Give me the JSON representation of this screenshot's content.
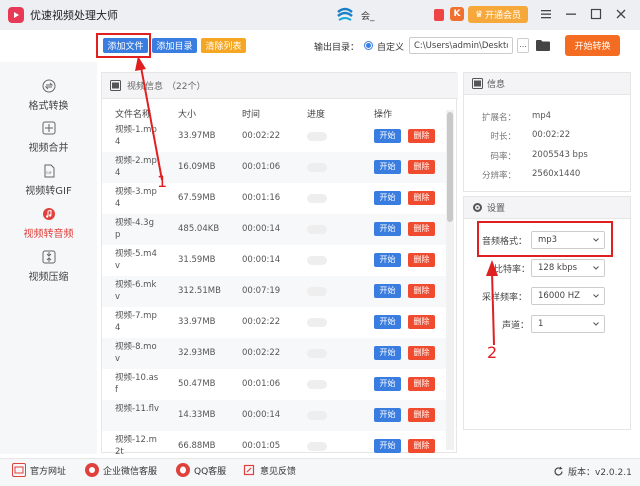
{
  "app": {
    "title": "优速视频处理大师",
    "user_name": "会_"
  },
  "vip": {
    "k_badge": "K",
    "label": "开通会员"
  },
  "toolbar": {
    "add_file": "添加文件",
    "add_dir": "添加目录",
    "clear_list": "清除列表",
    "output_dir_label": "输出目录：",
    "radio_custom": "自定义",
    "output_path": "C:\\Users\\admin\\Deskto",
    "more": "...",
    "start_convert": "开始转换"
  },
  "sidebar": {
    "items": [
      {
        "label": "格式转换",
        "icon": "format-convert-icon"
      },
      {
        "label": "视频合并",
        "icon": "video-merge-icon"
      },
      {
        "label": "视频转GIF",
        "icon": "gif-icon"
      },
      {
        "label": "视频转音频",
        "icon": "audio-icon",
        "active": true
      },
      {
        "label": "视频压缩",
        "icon": "compress-icon"
      }
    ]
  },
  "file_panel": {
    "title": "视频信息",
    "count": "（22个）",
    "columns": {
      "name": "文件名称",
      "size": "大小",
      "duration": "时间",
      "progress": "进度",
      "action": "操作"
    },
    "start_label": "开始",
    "delete_label": "删除",
    "rows": [
      {
        "name": "视频-1.mp4",
        "size": "33.97MB",
        "duration": "00:02:22"
      },
      {
        "name": "视频-2.mp4",
        "size": "16.09MB",
        "duration": "00:01:06"
      },
      {
        "name": "视频-3.mp4",
        "size": "67.59MB",
        "duration": "00:01:16"
      },
      {
        "name": "视频-4.3gp",
        "size": "485.04KB",
        "duration": "00:00:14"
      },
      {
        "name": "视频-5.m4v",
        "size": "31.59MB",
        "duration": "00:00:14"
      },
      {
        "name": "视频-6.mkv",
        "size": "312.51MB",
        "duration": "00:07:19"
      },
      {
        "name": "视频-7.mp4",
        "size": "33.97MB",
        "duration": "00:02:22"
      },
      {
        "name": "视频-8.mov",
        "size": "32.93MB",
        "duration": "00:02:22"
      },
      {
        "name": "视频-10.asf",
        "size": "50.47MB",
        "duration": "00:01:06"
      },
      {
        "name": "视频-11.flv",
        "size": "14.33MB",
        "duration": "00:00:14"
      },
      {
        "name": "视频-12.m2t",
        "size": "66.88MB",
        "duration": "00:01:05"
      }
    ]
  },
  "info_panel": {
    "title": "信息",
    "rows": [
      {
        "key": "扩展名：",
        "value": "mp4"
      },
      {
        "key": "时长：",
        "value": "00:02:22"
      },
      {
        "key": "码率：",
        "value": "2005543 bps"
      },
      {
        "key": "分辨率：",
        "value": "2560x1440"
      }
    ]
  },
  "settings_panel": {
    "title": "设置",
    "audio_format_label": "音频格式：",
    "audio_format": "mp3",
    "bitrate_label": "比特率：",
    "bitrate": "128 kbps",
    "sample_rate_label": "采样频率：",
    "sample_rate": "16000 HZ",
    "channels_label": "声道：",
    "channels": "1"
  },
  "annotations": {
    "one": "1",
    "two": "2"
  },
  "footer": {
    "website": "官方网址",
    "wechat": "企业微信客服",
    "qq": "QQ客服",
    "feedback": "意见反馈",
    "version": "版本：v2.0.2.1"
  },
  "colors": {
    "accent_blue": "#3a7de0",
    "accent_orange": "#f36c21",
    "danger_red": "#f04b2e",
    "annotation_red": "#e02020"
  }
}
